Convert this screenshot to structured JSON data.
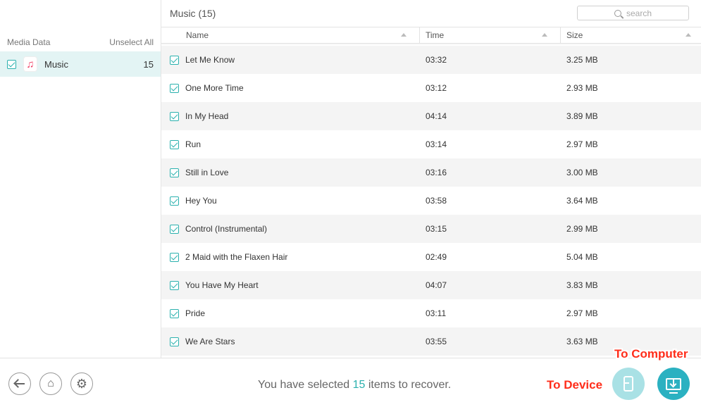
{
  "window": {
    "controls": [
      "close",
      "minimize",
      "maximize"
    ]
  },
  "sidebar": {
    "header_label": "Media Data",
    "unselect_all": "Unselect All",
    "items": [
      {
        "label": "Music",
        "count": "15",
        "icon": "music-note-icon",
        "checked": true
      }
    ]
  },
  "main": {
    "title": "Music (15)",
    "search_placeholder": "search",
    "columns": {
      "name": "Name",
      "time": "Time",
      "size": "Size"
    },
    "rows": [
      {
        "name": "Let Me Know",
        "time": "03:32",
        "size": "3.25 MB"
      },
      {
        "name": "One More Time",
        "time": "03:12",
        "size": "2.93 MB"
      },
      {
        "name": "In My Head",
        "time": "04:14",
        "size": "3.89 MB"
      },
      {
        "name": "Run",
        "time": "03:14",
        "size": "2.97 MB"
      },
      {
        "name": "Still in Love",
        "time": "03:16",
        "size": "3.00 MB"
      },
      {
        "name": "Hey You",
        "time": "03:58",
        "size": "3.64 MB"
      },
      {
        "name": "Control (Instrumental)",
        "time": "03:15",
        "size": "2.99 MB"
      },
      {
        "name": "2 Maid with the Flaxen Hair",
        "time": "02:49",
        "size": "5.04 MB"
      },
      {
        "name": "You Have My Heart",
        "time": "04:07",
        "size": "3.83 MB"
      },
      {
        "name": "Pride",
        "time": "03:11",
        "size": "2.97 MB"
      },
      {
        "name": "We Are Stars",
        "time": "03:55",
        "size": "3.63 MB"
      }
    ]
  },
  "footer": {
    "status_prefix": "You have selected ",
    "status_count": "15",
    "status_suffix": " items to recover.",
    "to_device_label": "To Device",
    "to_computer_label": "To Computer"
  },
  "colors": {
    "accent": "#2bb1ae",
    "highlight": "#e3f4f4",
    "annotation": "#ff2d1a"
  }
}
